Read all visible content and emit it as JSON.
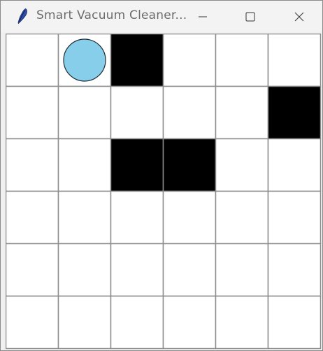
{
  "window": {
    "title": "Smart Vacuum Cleaner..."
  },
  "controls": {
    "minimize_icon": "minimize-icon",
    "maximize_icon": "maximize-icon",
    "close_icon": "close-icon"
  },
  "grid": {
    "rows": 6,
    "cols": 6,
    "obstacles": [
      {
        "row": 0,
        "col": 2
      },
      {
        "row": 1,
        "col": 5
      },
      {
        "row": 2,
        "col": 2
      },
      {
        "row": 2,
        "col": 3
      }
    ],
    "vacuum": {
      "row": 0,
      "col": 1
    },
    "colors": {
      "cell_bg": "#ffffff",
      "grid_line": "#8c8c8c",
      "obstacle": "#000000",
      "vacuum_fill": "#87ceeb",
      "vacuum_outline": "#1e2a33"
    }
  }
}
